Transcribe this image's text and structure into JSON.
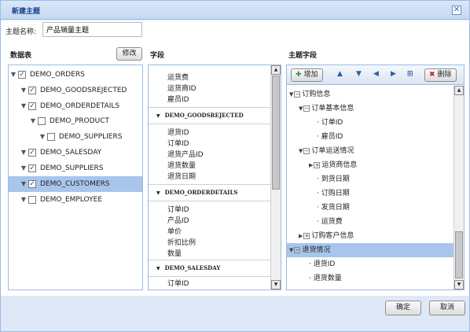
{
  "window": {
    "title": "新建主题"
  },
  "topic_name": {
    "label": "主题名称:",
    "value": "产品销量主题"
  },
  "tables": {
    "title": "数据表",
    "edit_label": "修改",
    "items": [
      {
        "label": "DEMO_ORDERS",
        "checked": true,
        "expanded": true
      },
      {
        "label": "DEMO_GOODSREJECTED",
        "checked": true
      },
      {
        "label": "DEMO_ORDERDETAILS",
        "checked": true
      },
      {
        "label": "DEMO_PRODUCT",
        "checked": false
      },
      {
        "label": "DEMO_SUPPLIERS",
        "checked": false
      },
      {
        "label": "DEMO_SALESDAY",
        "checked": true
      },
      {
        "label": "DEMO_SUPPLIERS",
        "checked": true
      },
      {
        "label": "DEMO_CUSTOMERS",
        "checked": true,
        "selected": true
      },
      {
        "label": "DEMO_EMPLOYEE",
        "checked": false
      }
    ]
  },
  "fields": {
    "title": "字段",
    "top_items": [
      "运货费",
      "运货商ID",
      "雇员ID"
    ],
    "sections": [
      {
        "name": "DEMO_GOODSREJECTED",
        "items": [
          "退货ID",
          "订单ID",
          "退货产品ID",
          "退货数量",
          "退货日期"
        ]
      },
      {
        "name": "DEMO_ORDERDETAILS",
        "items": [
          "订单ID",
          "产品ID",
          "单价",
          "折扣比例",
          "数量"
        ]
      },
      {
        "name": "DEMO_SALESDAY",
        "items": [
          "订单ID"
        ]
      }
    ]
  },
  "topic_fields": {
    "title": "主题字段",
    "add_label": "增加",
    "delete_label": "删除",
    "nodes": [
      {
        "label": "订购信息"
      },
      {
        "label": "订单基本信息"
      },
      {
        "label": "订单ID"
      },
      {
        "label": "雇员ID"
      },
      {
        "label": "订单运送情况"
      },
      {
        "label": "运货商信息"
      },
      {
        "label": "到货日期"
      },
      {
        "label": "订购日期"
      },
      {
        "label": "发货日期"
      },
      {
        "label": "运货费"
      },
      {
        "label": "订购客户信息"
      },
      {
        "label": "退货情况"
      },
      {
        "label": "退货ID"
      },
      {
        "label": "退货数量"
      }
    ]
  },
  "footer": {
    "ok_label": "确定",
    "cancel_label": "取消"
  },
  "colors": {
    "accent": "#99bbe8",
    "selection": "#a8c6ec",
    "title_text": "#15428b"
  }
}
